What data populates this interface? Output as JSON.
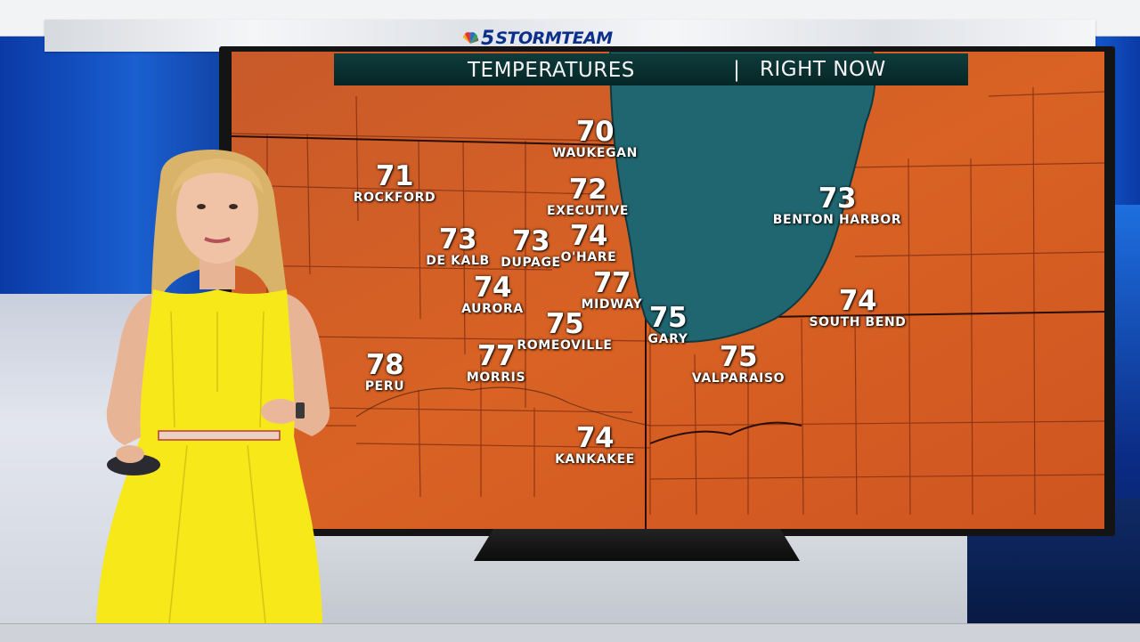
{
  "broadcast": {
    "station_number": "5",
    "brand": "STORMTEAM",
    "brand_color": "#0c2f8a"
  },
  "map": {
    "title_left": "TEMPERATURES",
    "title_separator": "|",
    "title_right": "RIGHT NOW",
    "land_color": "#d35a22",
    "lake_color": "#1e6470",
    "cities": [
      {
        "name": "WAUKEGAN",
        "temp": "70"
      },
      {
        "name": "ROCKFORD",
        "temp": "71"
      },
      {
        "name": "EXECUTIVE",
        "temp": "72"
      },
      {
        "name": "BENTON HARBOR",
        "temp": "73"
      },
      {
        "name": "DE KALB",
        "temp": "73"
      },
      {
        "name": "DUPAGE",
        "temp": "73"
      },
      {
        "name": "O'HARE",
        "temp": "74"
      },
      {
        "name": "AURORA",
        "temp": "74"
      },
      {
        "name": "MIDWAY",
        "temp": "77"
      },
      {
        "name": "ROMEOVILLE",
        "temp": "75"
      },
      {
        "name": "GARY",
        "temp": "75"
      },
      {
        "name": "SOUTH BEND",
        "temp": "74"
      },
      {
        "name": "PERU",
        "temp": "78"
      },
      {
        "name": "MORRIS",
        "temp": "77"
      },
      {
        "name": "VALPARAISO",
        "temp": "75"
      },
      {
        "name": "KANKAKEE",
        "temp": "74"
      }
    ]
  }
}
